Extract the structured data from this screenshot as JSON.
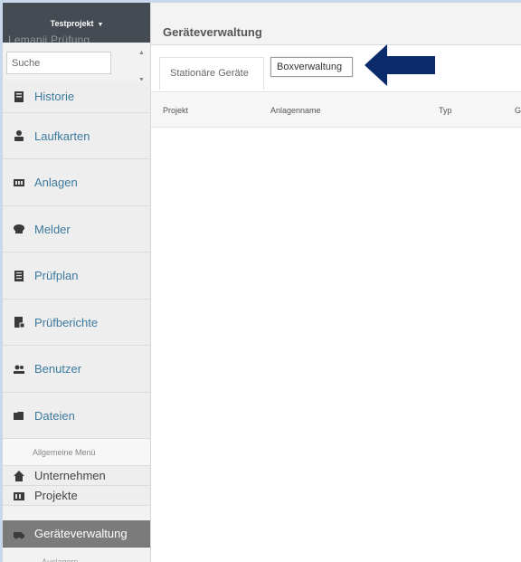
{
  "sidebar": {
    "hidden_label": "Lemanii Prüfung",
    "project_selector": "Testprojekt",
    "search_placeholder": "Suche",
    "items": [
      {
        "label": "Historie",
        "icon": "history-icon"
      },
      {
        "label": "Laufkarten",
        "icon": "route-card-icon"
      },
      {
        "label": "Anlagen",
        "icon": "installation-icon"
      },
      {
        "label": "Melder",
        "icon": "detector-icon"
      },
      {
        "label": "Prüfplan",
        "icon": "checklist-icon"
      },
      {
        "label": "Prüfberichte",
        "icon": "report-icon"
      },
      {
        "label": "Benutzer",
        "icon": "users-icon"
      },
      {
        "label": "Dateien",
        "icon": "folder-icon"
      }
    ],
    "general_menu_label": "Allgemeine Menü",
    "general_items": [
      {
        "label": "Unternehmen",
        "icon": "home-icon"
      },
      {
        "label": "Projekte",
        "icon": "projects-icon"
      },
      {
        "label": "Geräteverwaltung",
        "icon": "device-icon",
        "active": true
      }
    ],
    "clipped_item": "Auslagern"
  },
  "header": {
    "title": "Geräteverwaltung"
  },
  "tabs": [
    {
      "label": "Stationäre Geräte"
    },
    {
      "label": "Boxverwaltung"
    }
  ],
  "table": {
    "columns": [
      "Projekt",
      "Anlagenname",
      "Typ",
      "G"
    ]
  },
  "colors": {
    "sidebar_top": "#454b52",
    "nav_text": "#3c7a9e",
    "active_item": "#7b7b7b",
    "arrow": "#0b2a6b"
  }
}
